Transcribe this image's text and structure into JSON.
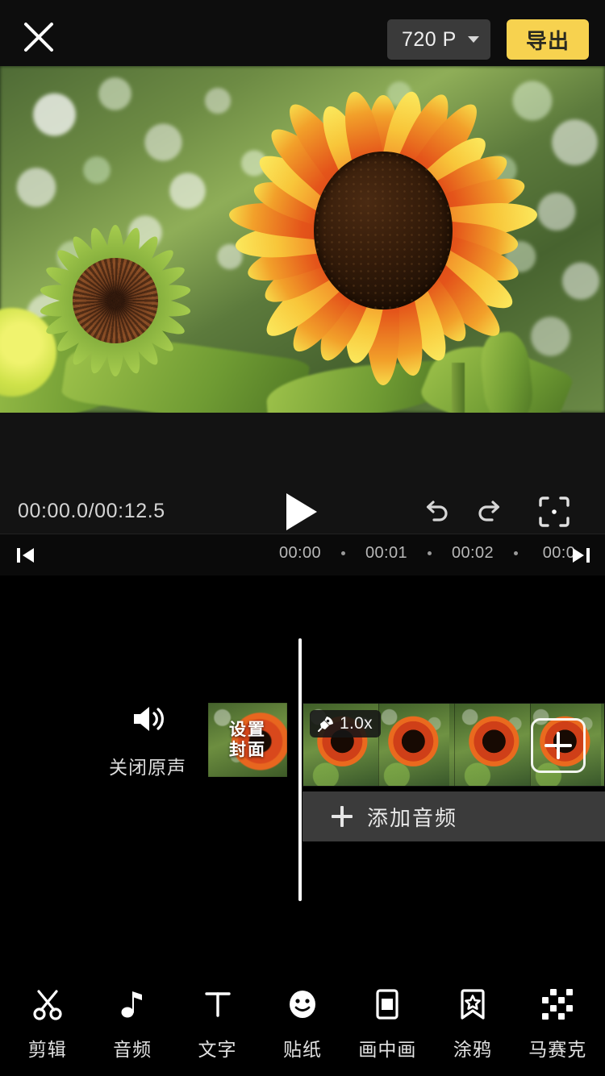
{
  "topbar": {
    "close_icon": "close-icon",
    "resolution": "720 P",
    "resolution_caret": "chevron-down-icon",
    "export_label": "导出"
  },
  "preview": {
    "content": "sunflower-video-frame"
  },
  "playback": {
    "timecode": "00:00.0/00:12.5",
    "current_time": "00:00.0",
    "total_time": "00:12.5",
    "play_icon": "play-icon",
    "undo_icon": "undo-icon",
    "redo_icon": "redo-icon",
    "fit_icon": "fit-screen-icon"
  },
  "ruler": {
    "skip_start_icon": "skip-to-start-icon",
    "skip_end_icon": "skip-to-end-icon",
    "ticks": [
      "00:00",
      "00:01",
      "00:02",
      "00:0"
    ]
  },
  "timeline": {
    "mute": {
      "icon": "speaker-icon",
      "label": "关闭原声"
    },
    "cover": {
      "line1": "设置",
      "line2": "封面"
    },
    "video_clip": {
      "speed_icon": "rocket-icon",
      "speed_label": "1.0x",
      "add_clip_icon": "plus-icon",
      "frames": 4
    },
    "audio_track": {
      "plus_icon": "plus-icon",
      "label": "添加音频"
    },
    "playhead": "playhead-handle"
  },
  "toolbar": {
    "items": [
      {
        "label": "剪辑",
        "icon": "scissors-icon"
      },
      {
        "label": "音频",
        "icon": "music-note-icon"
      },
      {
        "label": "文字",
        "icon": "text-t-icon"
      },
      {
        "label": "贴纸",
        "icon": "smiley-sticker-icon"
      },
      {
        "label": "画中画",
        "icon": "picture-in-picture-icon"
      },
      {
        "label": "涂鸦",
        "icon": "star-bookmark-icon"
      },
      {
        "label": "马赛克",
        "icon": "mosaic-icon"
      }
    ]
  },
  "colors": {
    "accent_yellow": "#f7d24f",
    "background": "#000000",
    "panel": "#131313",
    "track": "#3b3b3b",
    "text_primary": "#e8e8e8"
  }
}
